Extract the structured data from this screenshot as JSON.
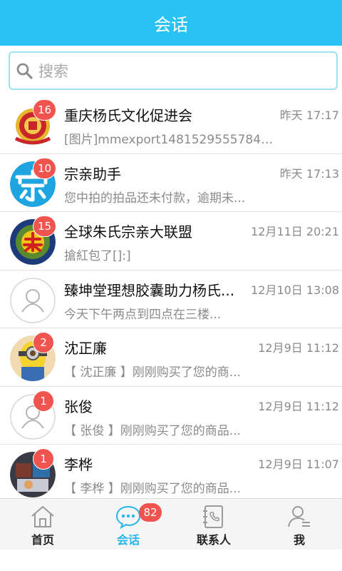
{
  "header": {
    "title": "会话"
  },
  "search": {
    "placeholder": "搜索"
  },
  "conversations": [
    {
      "name": "重庆杨氏文化促进会",
      "time": "昨天 17:17",
      "preview": "[图片]mmexport1481529555784....",
      "badge": "16",
      "avatar": "seal-logo"
    },
    {
      "name": "宗亲助手",
      "time": "昨天 17:13",
      "preview": "您中拍的拍品还未付款，逾期未...",
      "badge": "10",
      "avatar": "zong-character"
    },
    {
      "name": "全球朱氏宗亲大联盟",
      "time": "12月11日 20:21",
      "preview": "搶紅包了[]:]",
      "badge": "15",
      "avatar": "zhu-emblem"
    },
    {
      "name": "臻坤堂理想胶囊助力杨氏...",
      "time": "12月10日 13:08",
      "preview": "今天下午两点到四点在三楼...",
      "badge": "",
      "avatar": "default-person"
    },
    {
      "name": "沈正廉",
      "time": "12月9日 11:12",
      "preview": "【 沈正廉 】刚刚购买了您的商...",
      "badge": "2",
      "avatar": "minion-photo"
    },
    {
      "name": "张俊",
      "time": "12月9日 11:12",
      "preview": "【 张俊 】刚刚购买了您的商品...",
      "badge": "1",
      "avatar": "default-person"
    },
    {
      "name": "李桦",
      "time": "12月9日 11:07",
      "preview": "【 李桦 】刚刚购买了您的商品...",
      "badge": "1",
      "avatar": "photo"
    }
  ],
  "nav": {
    "home": "首页",
    "chat": "会话",
    "chat_badge": "82",
    "contacts": "联系人",
    "me": "我"
  },
  "colors": {
    "accent": "#28c3f3",
    "badge": "#f0544f"
  }
}
